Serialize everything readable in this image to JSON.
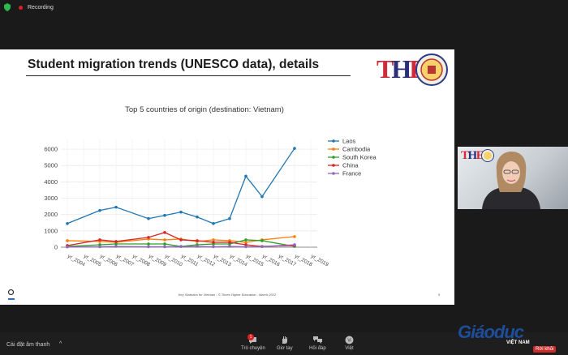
{
  "status": {
    "recording_label": "Recording"
  },
  "slide": {
    "title": "Student migration trends (UNESCO data), details",
    "logo_text": "THE",
    "footer": "Key Statistics for Vietnam  -  © Times Higher Education - March 2022",
    "page": "9"
  },
  "chart_data": {
    "type": "line",
    "title": "Top 5 countries of origin (destination: Vietnam)",
    "categories": [
      "yr_2004",
      "yr_2005",
      "yr_2006",
      "yr_2007",
      "yr_2008",
      "yr_2009",
      "yr_2010",
      "yr_2011",
      "yr_2012",
      "yr_2013",
      "yr_2014",
      "yr_2015",
      "yr_2016",
      "yr_2017",
      "yr_2018",
      "yr_2019"
    ],
    "ylim": [
      0,
      6500
    ],
    "yticks": [
      0,
      1000,
      2000,
      3000,
      4000,
      5000,
      6000
    ],
    "grid": true,
    "legend_position": "right",
    "series": [
      {
        "name": "Laos",
        "color": "#1f77b4",
        "values": [
          1450,
          null,
          2250,
          2450,
          null,
          1750,
          1950,
          2150,
          1850,
          1450,
          1750,
          4350,
          3100,
          null,
          6050,
          null
        ]
      },
      {
        "name": "Cambodia",
        "color": "#ff7f0e",
        "values": [
          400,
          null,
          350,
          300,
          null,
          500,
          450,
          500,
          350,
          450,
          400,
          300,
          450,
          null,
          650,
          null
        ]
      },
      {
        "name": "South Korea",
        "color": "#2ca02c",
        "values": [
          50,
          null,
          150,
          200,
          null,
          200,
          200,
          50,
          150,
          200,
          200,
          450,
          400,
          null,
          50,
          null
        ]
      },
      {
        "name": "China",
        "color": "#d62728",
        "values": [
          100,
          null,
          450,
          350,
          null,
          600,
          900,
          450,
          400,
          300,
          300,
          150,
          50,
          null,
          100,
          null
        ]
      },
      {
        "name": "France",
        "color": "#9467bd",
        "values": [
          20,
          null,
          30,
          50,
          null,
          30,
          30,
          40,
          50,
          30,
          50,
          30,
          40,
          null,
          150,
          null
        ]
      }
    ]
  },
  "video": {
    "logo_text": "THE"
  },
  "controls": {
    "audio_settings": "Cài đặt âm thanh",
    "chat": "Trò chuyện",
    "chat_badge": "1",
    "raise_hand": "Giơ tay",
    "qa": "Hỏi đáp",
    "language": "Việt",
    "leave": "Rời khỏi"
  },
  "watermark": {
    "main": "Giáoduc",
    "sub": "VIỆT NAM"
  }
}
